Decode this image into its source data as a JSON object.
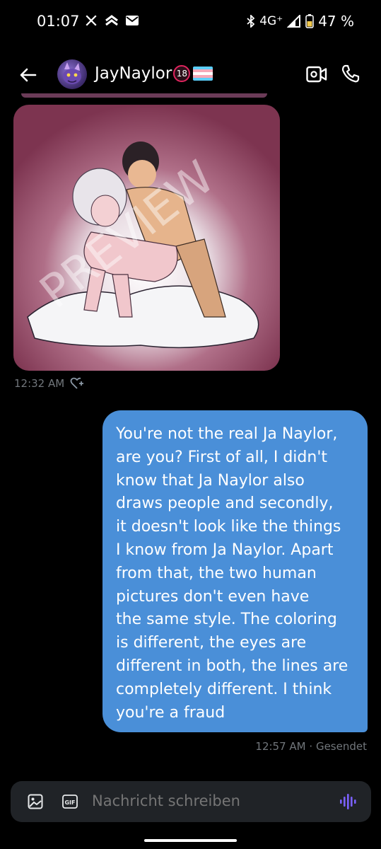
{
  "status_bar": {
    "time": "01:07",
    "network": "4G⁺",
    "battery": "47 %"
  },
  "header": {
    "title": "JayNaylor",
    "badge": "18"
  },
  "image_message": {
    "time": "12:32 AM",
    "watermark": "PREVIEW"
  },
  "sent_message": {
    "text": "You're not the real Ja Naylor,\nare you? First of all, I didn't\nknow that Ja Naylor also\ndraws people and secondly,\nit doesn't look like the things\nI know from Ja Naylor. Apart\nfrom that, the two human\npictures don't even have\nthe same style. The coloring\nis different, the eyes are\ndifferent in both, the lines are\ncompletely different. I think\nyou're a fraud",
    "time": "12:57 AM",
    "status": "Gesendet"
  },
  "composer": {
    "placeholder": "Nachricht schreiben",
    "gif_label": "GIF"
  },
  "colors": {
    "bubble": "#4a8fd8",
    "composer_bg": "#202327",
    "muted": "#71767b",
    "accent_voice": "#7b61ff"
  }
}
